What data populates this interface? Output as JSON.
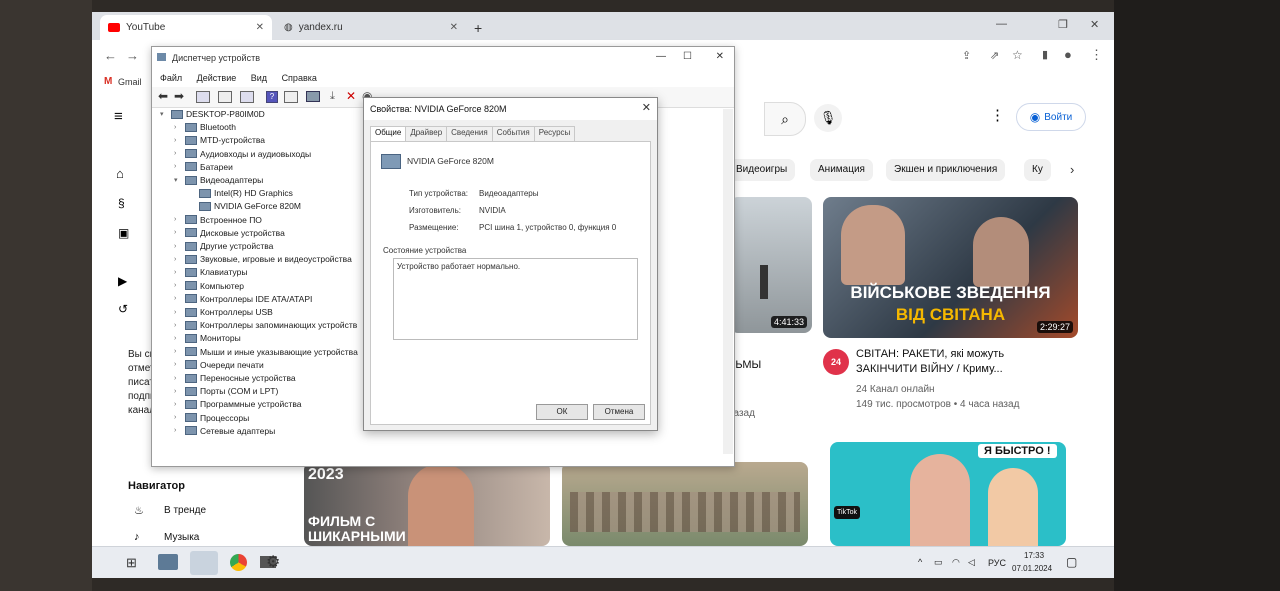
{
  "browser": {
    "tabs": [
      {
        "label": "YouTube",
        "active": true
      },
      {
        "label": "yandex.ru",
        "active": false
      }
    ],
    "new_tab": "+",
    "bookmark": "Gmail"
  },
  "youtube": {
    "signin_label": "Войти",
    "chips": [
      "Видеоигры",
      "Анимация",
      "Экшен и приключения",
      "Ку"
    ],
    "sidebar": {
      "subscribe_text": [
        "Вы смо",
        "отмет",
        "писать",
        "подпис",
        "канал"
      ],
      "navigator_title": "Навигатор",
      "navigator_items": [
        "В тренде",
        "Музыка"
      ]
    },
    "videos": [
      {
        "duration": "4:41:33",
        "title": "РЬМЫ",
        "meta": "назад"
      },
      {
        "duration": "2:29:27",
        "title": "СВІТАН: РАКЕТИ, які можуть ЗАКІНЧИТИ ВІЙНУ / Криму...",
        "channel": "24 Канал онлайн",
        "meta": "149 тис. просмотров • 4 часа назад",
        "thumb_text_1": "ВІЙСЬКОВЕ ЗВЕДЕННЯ",
        "thumb_text_2": "ВІД СВІТАНА"
      },
      {
        "thumb_text_1": "2023",
        "thumb_text_2": "ФИЛЬМ С ШИКАРНЫМИ"
      },
      {
        "thumb_text_1": "Я БЫСТРО !",
        "thumb_badge": "TikTok"
      }
    ]
  },
  "device_manager": {
    "title": "Диспетчер устройств",
    "menu": [
      "Файл",
      "Действие",
      "Вид",
      "Справка"
    ],
    "tree": [
      {
        "label": "DESKTOP-P80IM0D",
        "level": 0,
        "expanded": true
      },
      {
        "label": "Bluetooth",
        "level": 1
      },
      {
        "label": "MTD-устройства",
        "level": 1
      },
      {
        "label": "Аудиовходы и аудиовыходы",
        "level": 1
      },
      {
        "label": "Батареи",
        "level": 1
      },
      {
        "label": "Видеоадаптеры",
        "level": 1,
        "expanded": true
      },
      {
        "label": "Intel(R) HD Graphics",
        "level": 2
      },
      {
        "label": "NVIDIA GeForce 820M",
        "level": 2
      },
      {
        "label": "Встроенное ПО",
        "level": 1
      },
      {
        "label": "Дисковые устройства",
        "level": 1
      },
      {
        "label": "Другие устройства",
        "level": 1
      },
      {
        "label": "Звуковые, игровые и видеоустройства",
        "level": 1
      },
      {
        "label": "Клавиатуры",
        "level": 1
      },
      {
        "label": "Компьютер",
        "level": 1
      },
      {
        "label": "Контроллеры IDE ATA/ATAPI",
        "level": 1
      },
      {
        "label": "Контроллеры USB",
        "level": 1
      },
      {
        "label": "Контроллеры запоминающих устройств",
        "level": 1
      },
      {
        "label": "Мониторы",
        "level": 1
      },
      {
        "label": "Мыши и иные указывающие устройства",
        "level": 1
      },
      {
        "label": "Очереди печати",
        "level": 1
      },
      {
        "label": "Переносные устройства",
        "level": 1
      },
      {
        "label": "Порты (COM и LPT)",
        "level": 1
      },
      {
        "label": "Программные устройства",
        "level": 1
      },
      {
        "label": "Процессоры",
        "level": 1
      },
      {
        "label": "Сетевые адаптеры",
        "level": 1
      }
    ]
  },
  "properties": {
    "title": "Свойства: NVIDIA GeForce 820M",
    "tabs": [
      "Общие",
      "Драйвер",
      "Сведения",
      "События",
      "Ресурсы"
    ],
    "device_name": "NVIDIA GeForce 820M",
    "fields": [
      {
        "label": "Тип устройства:",
        "value": "Видеоадаптеры"
      },
      {
        "label": "Изготовитель:",
        "value": "NVIDIA"
      },
      {
        "label": "Размещение:",
        "value": "PCI шина 1, устройство 0, функция 0"
      }
    ],
    "status_title": "Состояние устройства",
    "status_text": "Устройство работает нормально.",
    "ok_label": "ОК",
    "cancel_label": "Отмена"
  },
  "taskbar": {
    "lang": "РУС",
    "time": "17:33",
    "date": "07.01.2024"
  },
  "colors": {
    "youtube_red": "#ff0000",
    "link_blue": "#065fd4"
  }
}
